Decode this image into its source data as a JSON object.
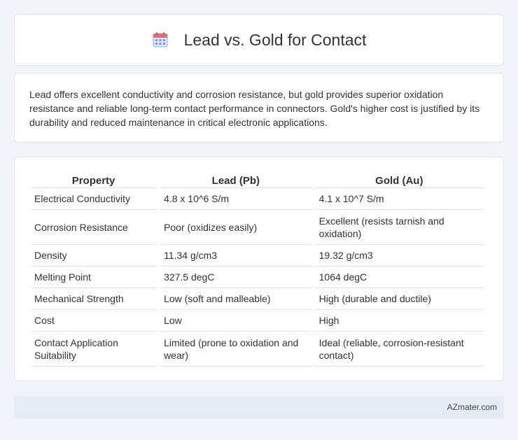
{
  "header": {
    "title": "Lead vs. Gold for Contact",
    "icon": "calendar-icon"
  },
  "summary": {
    "text": "Lead offers excellent conductivity and corrosion resistance, but gold provides superior oxidation resistance and reliable long-term contact performance in connectors. Gold's higher cost is justified by its durability and reduced maintenance in critical electronic applications."
  },
  "table": {
    "headers": [
      "Property",
      "Lead (Pb)",
      "Gold (Au)"
    ],
    "rows": [
      [
        "Electrical Conductivity",
        "4.8 x 10^6 S/m",
        "4.1 x 10^7 S/m"
      ],
      [
        "Corrosion Resistance",
        "Poor (oxidizes easily)",
        "Excellent (resists tarnish and oxidation)"
      ],
      [
        "Density",
        "11.34 g/cm3",
        "19.32 g/cm3"
      ],
      [
        "Melting Point",
        "327.5 degC",
        "1064 degC"
      ],
      [
        "Mechanical Strength",
        "Low (soft and malleable)",
        "High (durable and ductile)"
      ],
      [
        "Cost",
        "Low",
        "High"
      ],
      [
        "Contact Application Suitability",
        "Limited (prone to oxidation and wear)",
        "Ideal (reliable, corrosion-resistant contact)"
      ]
    ]
  },
  "footer": {
    "text": "AZmater.com"
  },
  "colors": {
    "background": "#f1f4f9",
    "card": "#ffffff",
    "footer": "#e6ecf6",
    "icon_blue": "#5b8def",
    "icon_red": "#e86a6a"
  }
}
